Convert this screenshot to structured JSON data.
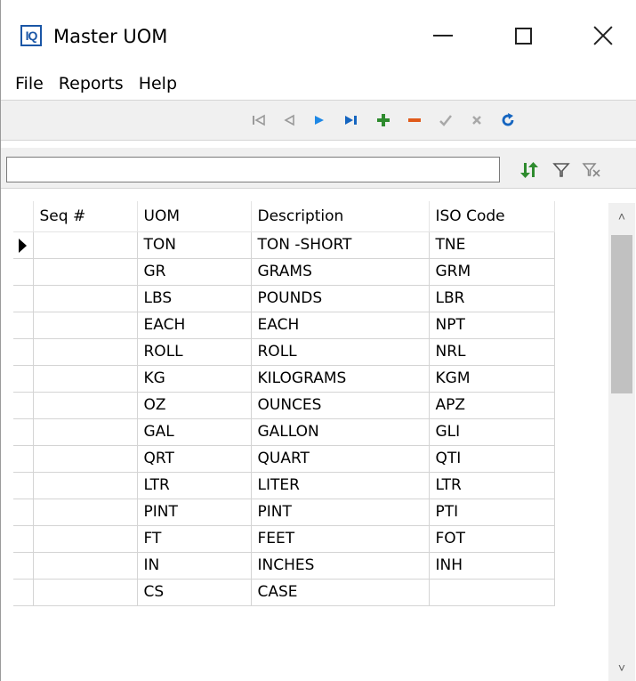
{
  "window": {
    "app_icon_text": "IQ",
    "title": "Master UOM"
  },
  "menu": [
    "File",
    "Reports",
    "Help"
  ],
  "toolbar": {
    "icons": [
      "first-record-icon",
      "prior-record-icon",
      "next-record-icon",
      "last-record-icon",
      "insert-record-icon",
      "delete-record-icon",
      "post-edit-icon",
      "cancel-edit-icon",
      "refresh-icon"
    ],
    "colors": {
      "nav_active": "#1565c0",
      "nav_inactive": "#9a9a9a",
      "insert": "#2e8b2e",
      "delete": "#e05a1a",
      "refresh": "#1565c0"
    }
  },
  "search": {
    "value": "",
    "placeholder": ""
  },
  "filter_icons": [
    "sort-icon",
    "filter-icon",
    "clear-filter-icon"
  ],
  "grid": {
    "columns": [
      "Seq #",
      "UOM",
      "Description",
      "ISO Code"
    ],
    "current_row": 0,
    "rows": [
      {
        "seq": "",
        "uom": "TON",
        "description": "TON -SHORT",
        "iso": "TNE"
      },
      {
        "seq": "",
        "uom": "GR",
        "description": "GRAMS",
        "iso": "GRM"
      },
      {
        "seq": "",
        "uom": "LBS",
        "description": "POUNDS",
        "iso": "LBR"
      },
      {
        "seq": "",
        "uom": "EACH",
        "description": "EACH",
        "iso": "NPT"
      },
      {
        "seq": "",
        "uom": "ROLL",
        "description": "ROLL",
        "iso": "NRL"
      },
      {
        "seq": "",
        "uom": "KG",
        "description": "KILOGRAMS",
        "iso": "KGM"
      },
      {
        "seq": "",
        "uom": "OZ",
        "description": "OUNCES",
        "iso": "APZ"
      },
      {
        "seq": "",
        "uom": "GAL",
        "description": "GALLON",
        "iso": "GLI"
      },
      {
        "seq": "",
        "uom": "QRT",
        "description": "QUART",
        "iso": "QTI"
      },
      {
        "seq": "",
        "uom": "LTR",
        "description": "LITER",
        "iso": "LTR"
      },
      {
        "seq": "",
        "uom": "PINT",
        "description": "PINT",
        "iso": "PTI"
      },
      {
        "seq": "",
        "uom": "FT",
        "description": "FEET",
        "iso": "FOT"
      },
      {
        "seq": "",
        "uom": "IN",
        "description": "INCHES",
        "iso": "INH"
      },
      {
        "seq": "",
        "uom": "CS",
        "description": "CASE",
        "iso": ""
      }
    ]
  },
  "scrollbar": {
    "up": "^",
    "down": "v"
  }
}
